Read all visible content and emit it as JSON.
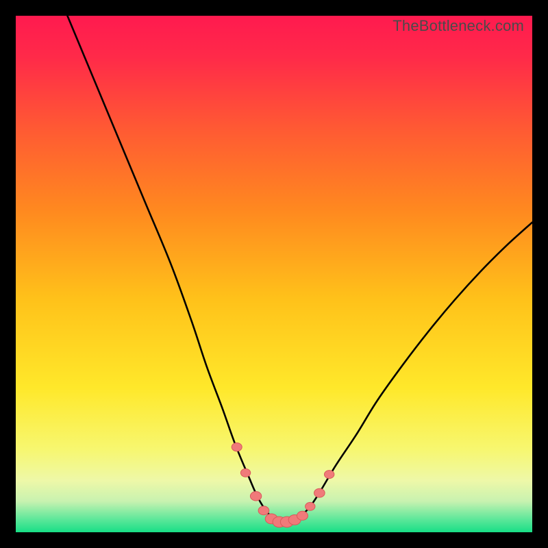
{
  "watermark": "TheBottleneck.com",
  "colors": {
    "frame": "#000000",
    "curve": "#000000",
    "marker_fill": "#f07a7a",
    "marker_stroke": "#d85a5a",
    "gradient_stops": [
      {
        "offset": 0.0,
        "color": "#ff1a4f"
      },
      {
        "offset": 0.08,
        "color": "#ff2a49"
      },
      {
        "offset": 0.22,
        "color": "#ff5a33"
      },
      {
        "offset": 0.38,
        "color": "#ff8a1f"
      },
      {
        "offset": 0.55,
        "color": "#ffc21a"
      },
      {
        "offset": 0.72,
        "color": "#ffe82a"
      },
      {
        "offset": 0.84,
        "color": "#f7f770"
      },
      {
        "offset": 0.9,
        "color": "#eef8a8"
      },
      {
        "offset": 0.94,
        "color": "#c8f2b0"
      },
      {
        "offset": 0.975,
        "color": "#5de79a"
      },
      {
        "offset": 1.0,
        "color": "#18df86"
      }
    ]
  },
  "chart_data": {
    "type": "line",
    "title": "",
    "xlabel": "",
    "ylabel": "",
    "xlim": [
      0,
      100
    ],
    "ylim": [
      0,
      100
    ],
    "series": [
      {
        "name": "bottleneck-curve",
        "x": [
          10,
          15,
          20,
          25,
          30,
          34,
          37,
          40,
          42.5,
          45,
          47,
          49,
          51,
          53,
          55,
          57,
          59,
          62,
          66,
          70,
          75,
          80,
          85,
          90,
          95,
          100
        ],
        "y": [
          100,
          88,
          76,
          64,
          52,
          41,
          32,
          24,
          17,
          11,
          6.5,
          3.5,
          2,
          2,
          3,
          5,
          8,
          13,
          19,
          25.5,
          32.5,
          39,
          45,
          50.5,
          55.5,
          60
        ]
      }
    ],
    "markers": {
      "name": "highlight-points",
      "x": [
        42.8,
        44.5,
        46.5,
        48.0,
        49.5,
        51.0,
        52.5,
        54.0,
        55.5,
        57.0,
        58.8,
        60.7
      ],
      "y": [
        16.5,
        11.5,
        7.0,
        4.2,
        2.6,
        2.0,
        2.0,
        2.4,
        3.2,
        5.0,
        7.6,
        11.2
      ],
      "r": [
        7.5,
        7.2,
        8.2,
        7.8,
        9.0,
        9.5,
        9.5,
        9.0,
        8.0,
        7.2,
        7.8,
        7.2
      ]
    }
  }
}
